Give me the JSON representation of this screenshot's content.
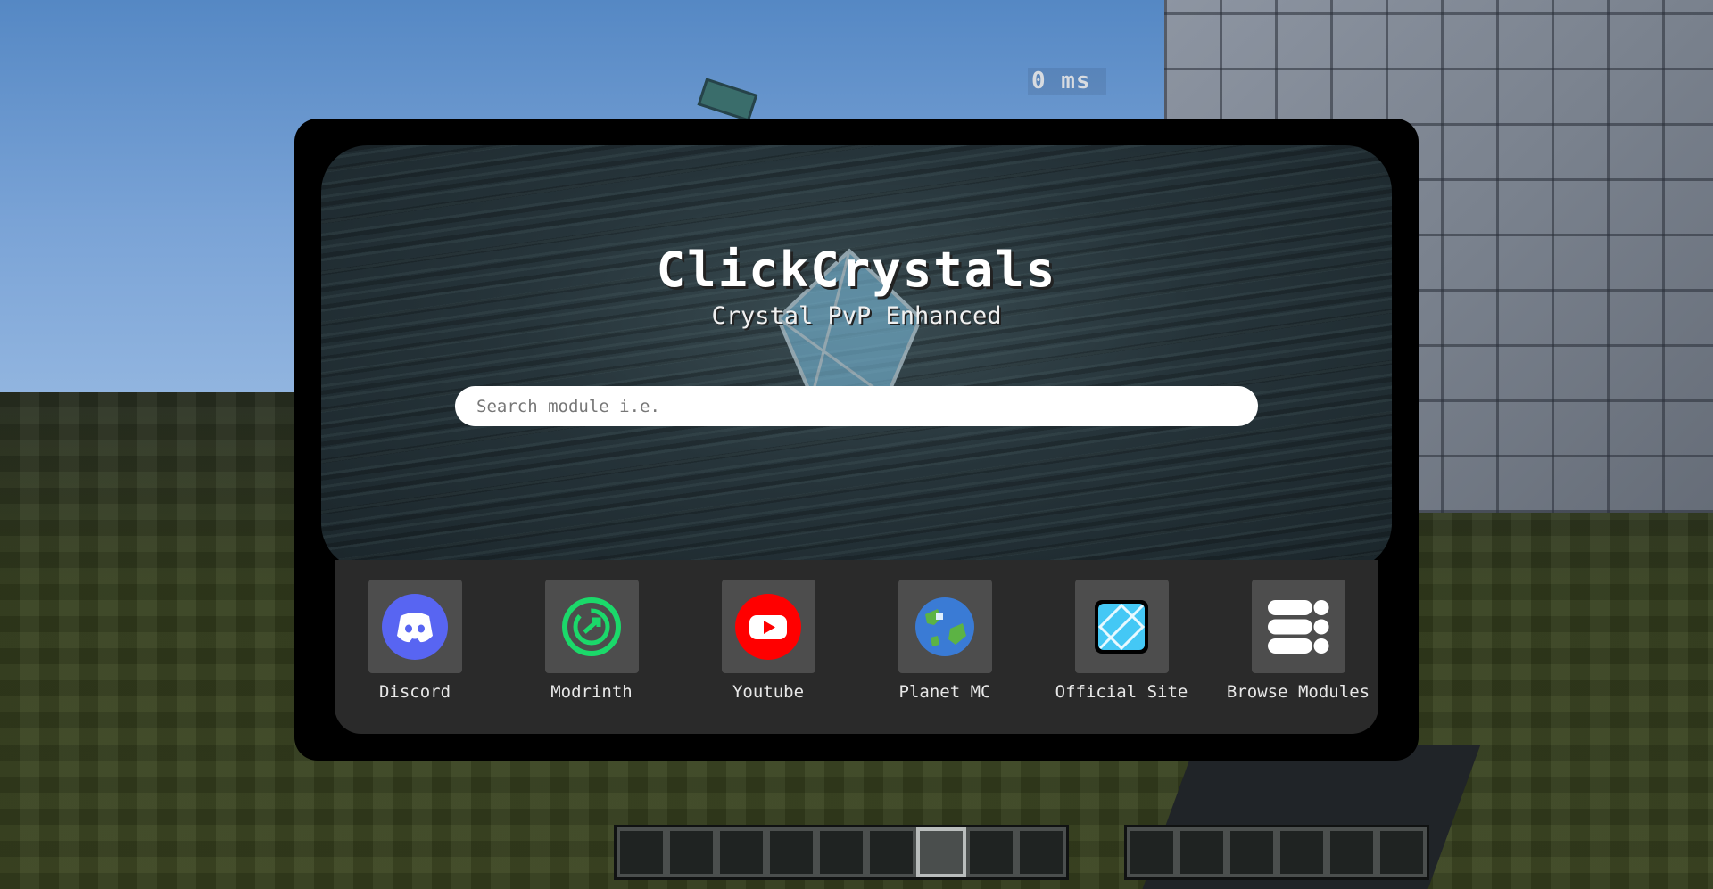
{
  "background": {
    "hud_ping": "0 ms"
  },
  "hero": {
    "title": "ClickCrystals",
    "subtitle": "Crystal PvP Enhanced",
    "logo_icon": "crystal-logo-icon"
  },
  "search": {
    "placeholder": "Search module i.e."
  },
  "links": [
    {
      "label": "Discord",
      "icon": "discord-icon",
      "color": "#5865F2"
    },
    {
      "label": "Modrinth",
      "icon": "modrinth-icon",
      "color": "#1BD96A"
    },
    {
      "label": "Youtube",
      "icon": "youtube-icon",
      "color": "#FF0000"
    },
    {
      "label": "Planet MC",
      "icon": "planet-icon",
      "color": "#3A7BD5"
    },
    {
      "label": "Official Site",
      "icon": "crystal-site-icon",
      "color": "#44C8F5"
    },
    {
      "label": "Browse Modules",
      "icon": "modules-list-icon",
      "color": "#FFFFFF"
    }
  ],
  "hotbar": {
    "left_slots": 9,
    "right_slots": 6,
    "selected_slot": 6
  },
  "colors": {
    "panel": "#000000",
    "links_bar": "#2A2A2A",
    "tile": "#4D4D4D",
    "text": "#FFFFFF"
  }
}
